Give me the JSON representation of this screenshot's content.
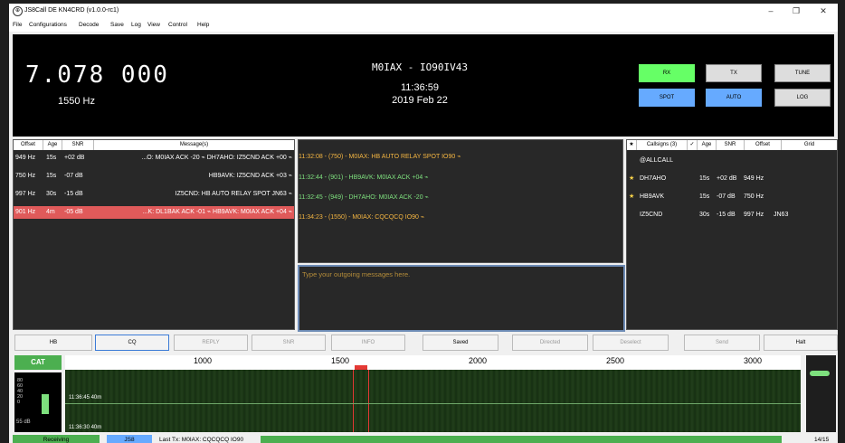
{
  "window": {
    "title": "JS8Call DE KN4CRD (v1.0.0-rc1)",
    "minimize": "–",
    "maximize": "❐",
    "close": "✕"
  },
  "menu": [
    "File",
    "Configurations",
    "Decode",
    "Save",
    "Log",
    "View",
    "Control",
    "Help"
  ],
  "display": {
    "frequency": "7.078 000",
    "offset_hz": "1550 Hz",
    "callsign": "M0IAX - IO90IV43",
    "time": "11:36:59",
    "date": "2019 Feb 22",
    "buttons": {
      "rx": "RX",
      "tx": "TX",
      "tune": "TUNE",
      "spot": "SPOT",
      "auto": "AUTO",
      "log": "LOG"
    },
    "colors": {
      "rx": "#66ff66",
      "spot": "#66aaff",
      "auto": "#66aaff"
    }
  },
  "band": {
    "headers": [
      "Offset",
      "Age",
      "SNR",
      "Message(s)"
    ],
    "rows": [
      {
        "offset": "949 Hz",
        "age": "15s",
        "snr": "+02 dB",
        "msg": "...O: M0IAX ACK -20 ⌁ DH7AHO: IZ5CND ACK +00 ⌁"
      },
      {
        "offset": "750 Hz",
        "age": "15s",
        "snr": "-07 dB",
        "msg": "HB9AVK: IZ5CND ACK +03 ⌁"
      },
      {
        "offset": "997 Hz",
        "age": "30s",
        "snr": "-15 dB",
        "msg": "IZ5CND: HB AUTO RELAY SPOT JN63 ⌁"
      },
      {
        "offset": "901 Hz",
        "age": "4m",
        "snr": "-05 dB",
        "msg": "...K: DL1BAK ACK -01 ⌁ HB9AVK: M0IAX ACK +04 ⌁"
      }
    ]
  },
  "activity": [
    {
      "text": "11:32:08 - (750) - M0IAX: HB AUTO RELAY SPOT IO90 ⌁",
      "color": "#f5b642"
    },
    {
      "text": "11:32:44 - (901) - HB9AVK: M0IAX ACK +04 ⌁",
      "color": "#7ee07e"
    },
    {
      "text": "11:32:45 - (949) - DH7AHO: M0IAX ACK -20 ⌁",
      "color": "#7ee07e"
    },
    {
      "text": "11:34:23 - (1550) - M0IAX: CQCQCQ IO90 ⌁",
      "color": "#f5b642"
    }
  ],
  "outgoing": {
    "placeholder": "Type your outgoing messages here."
  },
  "calls": {
    "headers": [
      "★",
      "Callsigns (3)",
      "✓",
      "Age",
      "SNR",
      "Offset",
      "Grid"
    ],
    "rows": [
      {
        "star": "",
        "call": "@ALLCALL",
        "age": "",
        "snr": "",
        "offset": "",
        "grid": ""
      },
      {
        "star": "★",
        "call": "DH7AHO",
        "age": "15s",
        "snr": "+02 dB",
        "offset": "949 Hz",
        "grid": ""
      },
      {
        "star": "★",
        "call": "HB9AVK",
        "age": "15s",
        "snr": "-07 dB",
        "offset": "750 Hz",
        "grid": ""
      },
      {
        "star": "",
        "call": "IZ5CND",
        "age": "30s",
        "snr": "-15 dB",
        "offset": "997 Hz",
        "grid": "JN63"
      }
    ]
  },
  "buttons": [
    "HB",
    "CQ",
    "REPLY",
    "SNR",
    "INFO",
    "Saved",
    "Directed",
    "Deselect",
    "Send",
    "Halt"
  ],
  "waterfall": {
    "cat": "CAT",
    "scale": [
      "80",
      "60",
      "40",
      "20",
      "0"
    ],
    "db": "55 dB",
    "ticks": [
      "1000",
      "1500",
      "2000",
      "2500",
      "3000"
    ],
    "marker1": "11:36:45  40m",
    "marker2": "11:36:30  40m"
  },
  "status": {
    "state": "Receiving",
    "mode": "JS8",
    "last_tx": "Last Tx: M0IAX: CQCQCQ IO90",
    "page": "14/15"
  }
}
